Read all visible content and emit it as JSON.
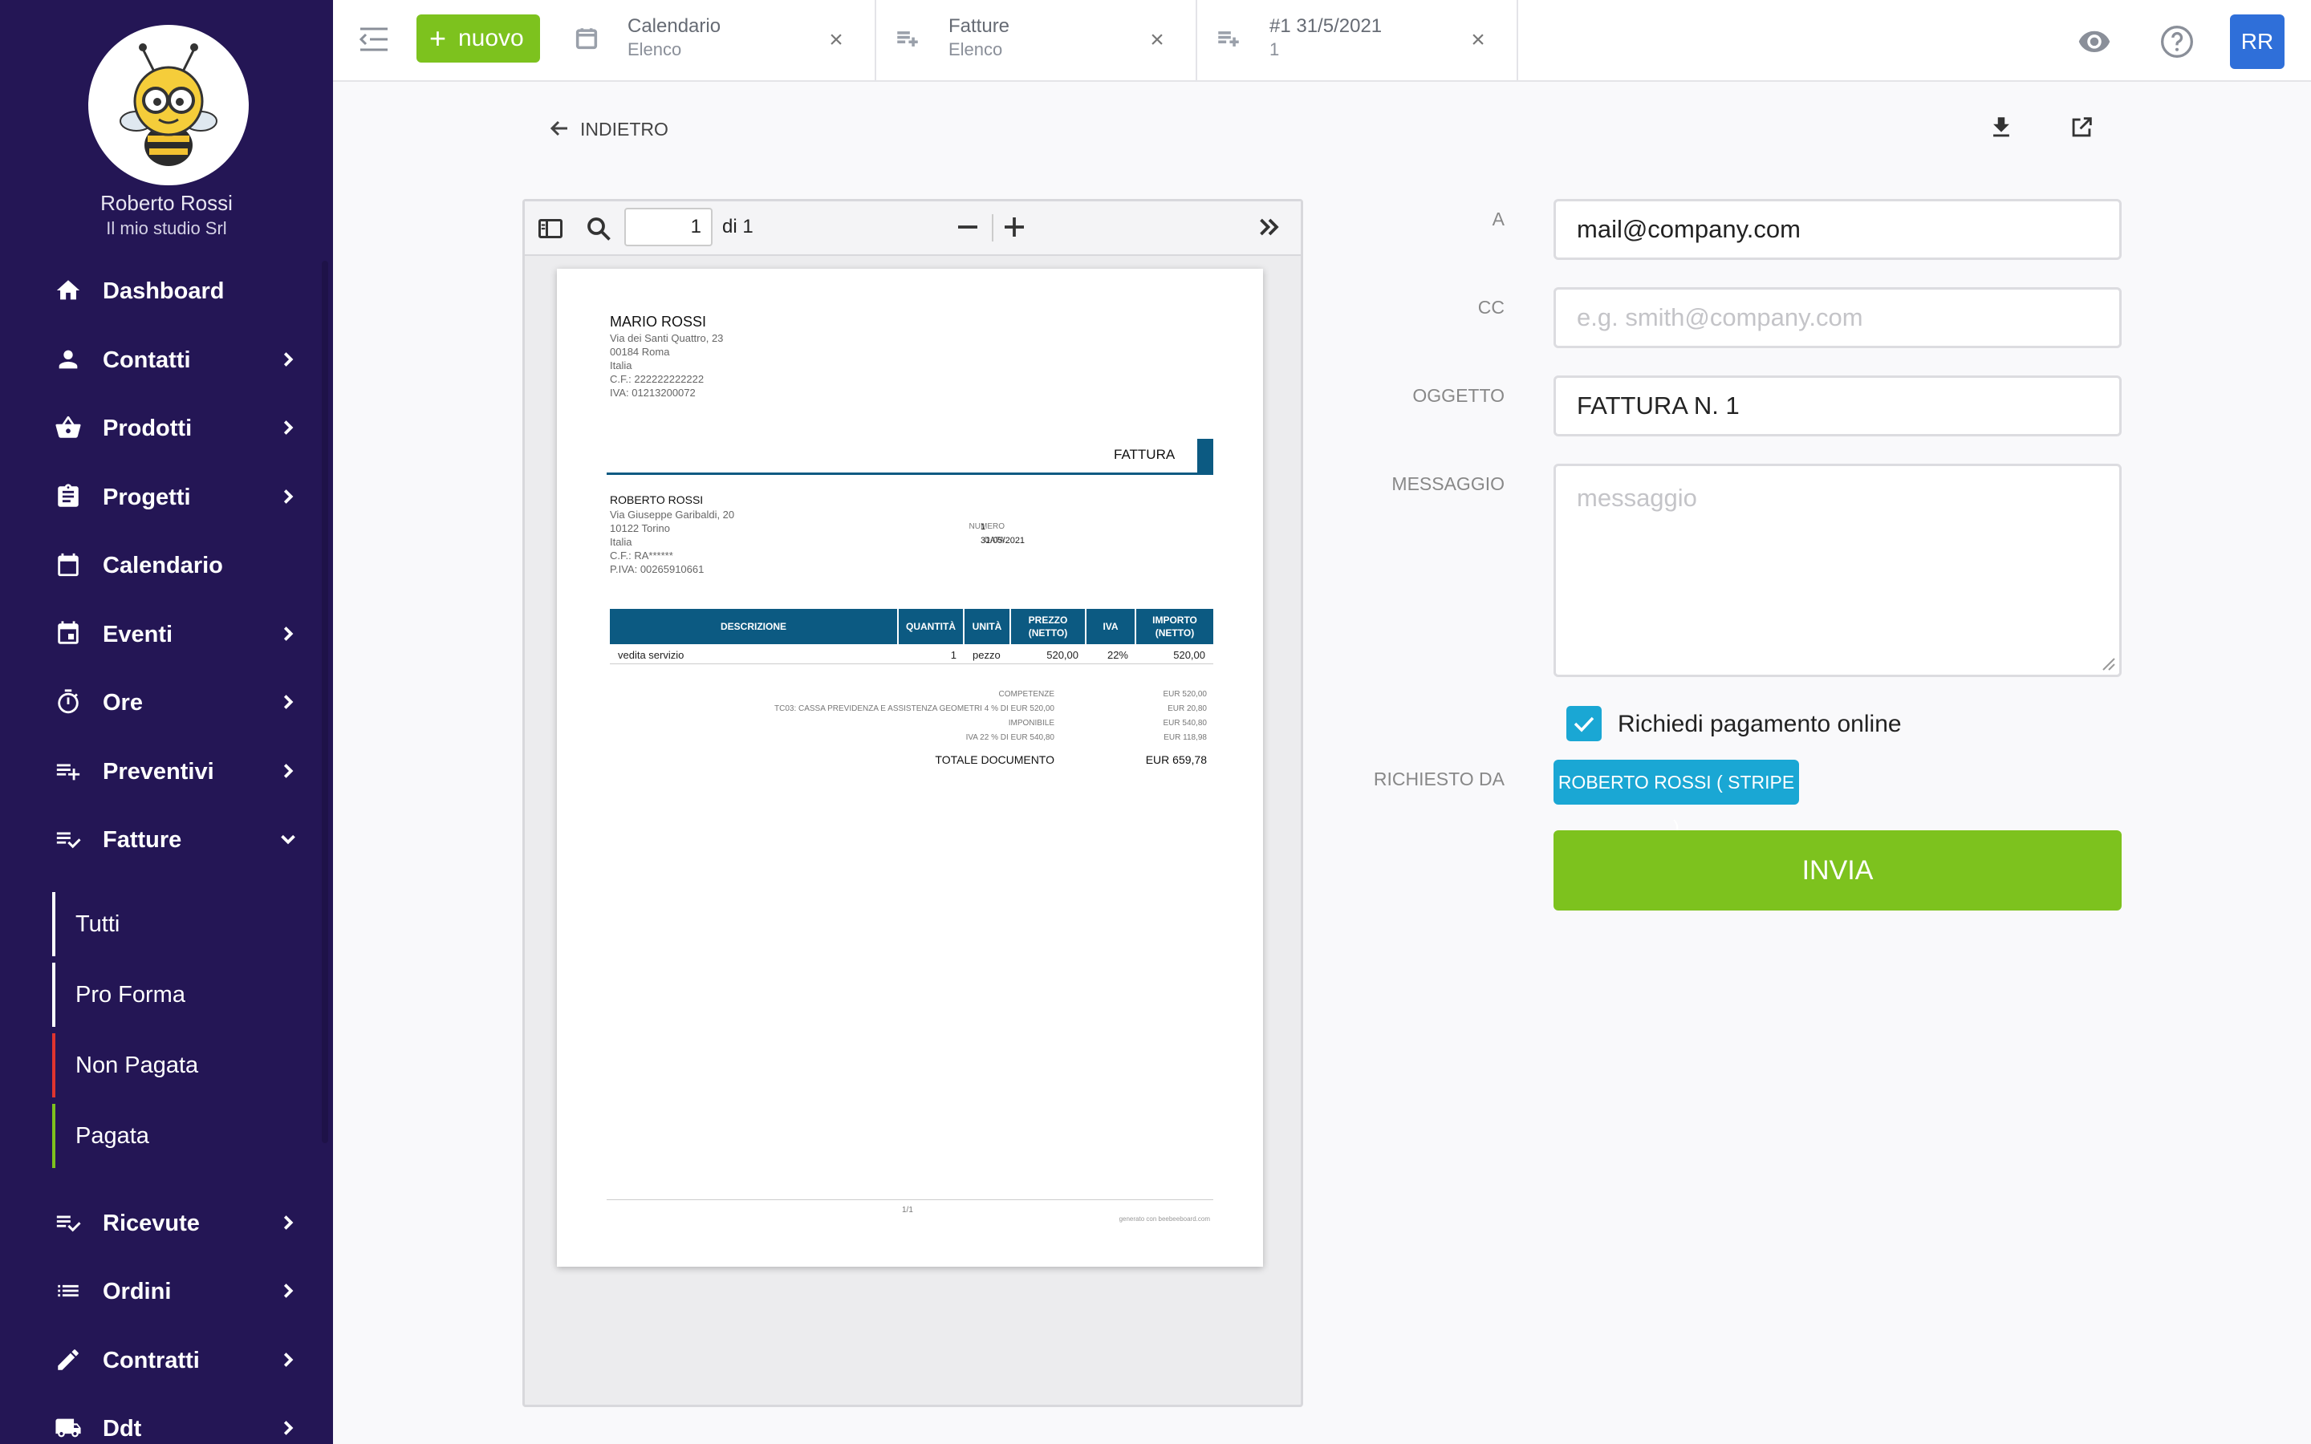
{
  "user": {
    "name": "Roberto Rossi",
    "company": "Il mio studio Srl",
    "initials": "RR"
  },
  "sidebar": {
    "items": [
      {
        "label": "Dashboard",
        "icon": "home-icon",
        "chevron": false
      },
      {
        "label": "Contatti",
        "icon": "person-icon",
        "chevron": true
      },
      {
        "label": "Prodotti",
        "icon": "basket-icon",
        "chevron": true
      },
      {
        "label": "Progetti",
        "icon": "clipboard-icon",
        "chevron": true
      },
      {
        "label": "Calendario",
        "icon": "calendar-icon",
        "chevron": false
      },
      {
        "label": "Eventi",
        "icon": "event-icon",
        "chevron": true
      },
      {
        "label": "Ore",
        "icon": "timer-icon",
        "chevron": true
      },
      {
        "label": "Preventivi",
        "icon": "playlist-add-icon",
        "chevron": true
      },
      {
        "label": "Fatture",
        "icon": "playlist-check-icon",
        "chevron": "down"
      }
    ],
    "fatture_sub": [
      {
        "label": "Tutti",
        "color": "#ffffff"
      },
      {
        "label": "Pro Forma",
        "color": "#ffffff"
      },
      {
        "label": "Non Pagata",
        "color": "#e0342f"
      },
      {
        "label": "Pagata",
        "color": "#7dc21e"
      }
    ],
    "items_after": [
      {
        "label": "Ricevute",
        "icon": "playlist-check-icon",
        "chevron": true
      },
      {
        "label": "Ordini",
        "icon": "list-icon",
        "chevron": true
      },
      {
        "label": "Contratti",
        "icon": "pencil-icon",
        "chevron": true
      },
      {
        "label": "Ddt",
        "icon": "truck-icon",
        "chevron": true
      }
    ]
  },
  "topbar": {
    "new_label": "nuovo",
    "tabs": [
      {
        "title": "Calendario",
        "subtitle": "Elenco",
        "icon": "calendar-icon"
      },
      {
        "title": "Fatture",
        "subtitle": "Elenco",
        "icon": "playlist-add-icon"
      },
      {
        "title": "#1 31/5/2021",
        "subtitle": "1",
        "icon": "playlist-add-icon"
      }
    ],
    "close_glyph": "×"
  },
  "main": {
    "back_label": "INDIETRO"
  },
  "pdf": {
    "page": "1",
    "total": "di 1",
    "doc": {
      "sender": {
        "name": "MARIO ROSSI",
        "lines": [
          "Via dei Santi Quattro, 23",
          "00184 Roma",
          "Italia",
          "C.F.: 222222222222",
          "IVA: 01213200072"
        ]
      },
      "doc_type": "FATTURA",
      "recipient": {
        "name": "ROBERTO ROSSI",
        "lines": [
          "Via Giuseppe Garibaldi, 20",
          "10122 Torino",
          "Italia",
          "C.F.: RA******",
          "P.IVA: 00265910661"
        ]
      },
      "numero_label": "NUMERO",
      "numero": "1",
      "data_label": "DATA",
      "data": "31/05/2021",
      "columns": [
        "DESCRIZIONE",
        "QUANTITÀ",
        "UNITÀ",
        "PREZZO (NETTO)",
        "IVA",
        "IMPORTO (NETTO)"
      ],
      "rows": [
        [
          "vedita servizio",
          "1",
          "pezzo",
          "520,00",
          "22%",
          "520,00"
        ]
      ],
      "totals": [
        [
          "COMPETENZE",
          "EUR 520,00"
        ],
        [
          "TC03: CASSA PREVIDENZA E ASSISTENZA GEOMETRI 4 % DI EUR 520,00",
          "EUR 20,80"
        ],
        [
          "IMPONIBILE",
          "EUR 540,80"
        ],
        [
          "IVA 22 % DI EUR 540,80",
          "EUR 118,98"
        ]
      ],
      "total_label": "TOTALE DOCUMENTO",
      "total_value": "EUR 659,78",
      "footer_page": "1/1",
      "footer_gen": "generato con beebeeboard.com"
    }
  },
  "form": {
    "to_label": "A",
    "to_value": "mail@company.com",
    "cc_label": "CC",
    "cc_placeholder": "e.g. smith@company.com",
    "subject_label": "OGGETTO",
    "subject_value": "FATTURA N. 1",
    "message_label": "MESSAGGIO",
    "message_placeholder": "messaggio",
    "online_label": "Richiedi pagamento online",
    "online_checked": true,
    "requested_by_label": "RICHIESTO DA",
    "requested_by_value": "ROBERTO ROSSI ( STRIPE )",
    "send_label": "INVIA"
  },
  "colors": {
    "sidebar": "#241655",
    "accent_green": "#7dc21e",
    "accent_blue": "#1aa7d4",
    "table_header": "#0c5a82"
  }
}
